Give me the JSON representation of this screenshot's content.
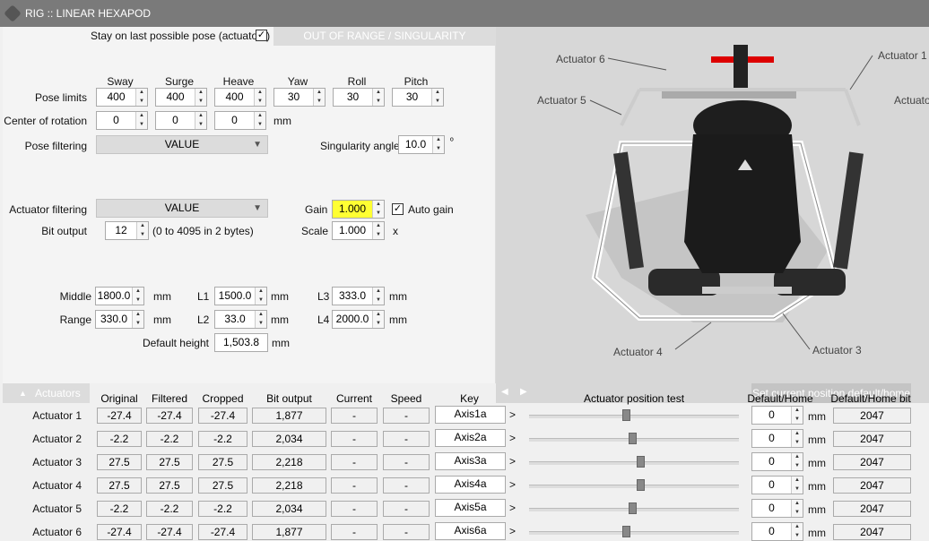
{
  "window": {
    "title": "RIG :: LINEAR HEXAPOD",
    "icon": "hexapod-app-icon"
  },
  "top": {
    "stay_label": "Stay on last possible pose (actuators)",
    "stay_checked": true,
    "out_of_range": "OUT OF RANGE / SINGULARITY"
  },
  "columns": [
    "Sway",
    "Surge",
    "Heave",
    "Yaw",
    "Roll",
    "Pitch"
  ],
  "pose_limits": {
    "label": "Pose limits",
    "values": [
      "400",
      "400",
      "400",
      "30",
      "30",
      "30"
    ]
  },
  "center_rotation": {
    "label": "Center of rotation",
    "values": [
      "0",
      "0",
      "0"
    ],
    "unit": "mm"
  },
  "pose_filtering": {
    "label": "Pose filtering",
    "value": "VALUE"
  },
  "singularity": {
    "label": "Singularity angle",
    "value": "10.0",
    "unit": "º"
  },
  "actuator_filtering": {
    "label": "Actuator filtering",
    "value": "VALUE"
  },
  "gain": {
    "label": "Gain",
    "value": "1.000",
    "auto_label": "Auto gain",
    "auto_checked": true
  },
  "bit_output": {
    "label": "Bit output",
    "value": "12",
    "note": "(0 to 4095 in 2 bytes)"
  },
  "scale": {
    "label": "Scale",
    "value": "1.000",
    "unit": "x"
  },
  "middle": {
    "label": "Middle",
    "value": "1800.0",
    "unit": "mm"
  },
  "range": {
    "label": "Range",
    "value": "330.0",
    "unit": "mm"
  },
  "l1": {
    "label": "L1",
    "value": "1500.0",
    "unit": "mm"
  },
  "l2": {
    "label": "L2",
    "value": "33.0",
    "unit": "mm"
  },
  "l3": {
    "label": "L3",
    "value": "333.0",
    "unit": "mm"
  },
  "l4": {
    "label": "L4",
    "value": "2000.0",
    "unit": "mm"
  },
  "default_height": {
    "label": "Default height",
    "value": "1,503.8",
    "unit": "mm"
  },
  "viewport_labels": [
    "Actuator 6",
    "Actuator 1",
    "Actuator 5",
    "Actuato",
    "Actuator 4",
    "Actuator 3"
  ],
  "actuators_tab": {
    "label": "Actuators",
    "icon": "triangle-up-icon"
  },
  "nav": {
    "prev": "◀",
    "next": "▶",
    "set_button": "Set current position default/home"
  },
  "table": {
    "headers": {
      "original": "Original",
      "filtered": "Filtered",
      "cropped": "Cropped",
      "bit": "Bit output",
      "current": "Current",
      "speed": "Speed",
      "key": "Key",
      "test": "Actuator position test",
      "default": "Default/Home",
      "default_bit": "Default/Home bit"
    },
    "rows": [
      {
        "name": "Actuator 1",
        "original": "-27.4",
        "filtered": "-27.4",
        "cropped": "-27.4",
        "bit": "1,877",
        "current": "-",
        "speed": "-",
        "key": "Axis1a",
        "test_pos": 0.46,
        "default": "0",
        "unit": "mm",
        "default_bit": "2047"
      },
      {
        "name": "Actuator 2",
        "original": "-2.2",
        "filtered": "-2.2",
        "cropped": "-2.2",
        "bit": "2,034",
        "current": "-",
        "speed": "-",
        "key": "Axis2a",
        "test_pos": 0.49,
        "default": "0",
        "unit": "mm",
        "default_bit": "2047"
      },
      {
        "name": "Actuator 3",
        "original": "27.5",
        "filtered": "27.5",
        "cropped": "27.5",
        "bit": "2,218",
        "current": "-",
        "speed": "-",
        "key": "Axis3a",
        "test_pos": 0.53,
        "default": "0",
        "unit": "mm",
        "default_bit": "2047"
      },
      {
        "name": "Actuator 4",
        "original": "27.5",
        "filtered": "27.5",
        "cropped": "27.5",
        "bit": "2,218",
        "current": "-",
        "speed": "-",
        "key": "Axis4a",
        "test_pos": 0.53,
        "default": "0",
        "unit": "mm",
        "default_bit": "2047"
      },
      {
        "name": "Actuator 5",
        "original": "-2.2",
        "filtered": "-2.2",
        "cropped": "-2.2",
        "bit": "2,034",
        "current": "-",
        "speed": "-",
        "key": "Axis5a",
        "test_pos": 0.49,
        "default": "0",
        "unit": "mm",
        "default_bit": "2047"
      },
      {
        "name": "Actuator 6",
        "original": "-27.4",
        "filtered": "-27.4",
        "cropped": "-27.4",
        "bit": "1,877",
        "current": "-",
        "speed": "-",
        "key": "Axis6a",
        "test_pos": 0.46,
        "default": "0",
        "unit": "mm",
        "default_bit": "2047"
      }
    ]
  }
}
